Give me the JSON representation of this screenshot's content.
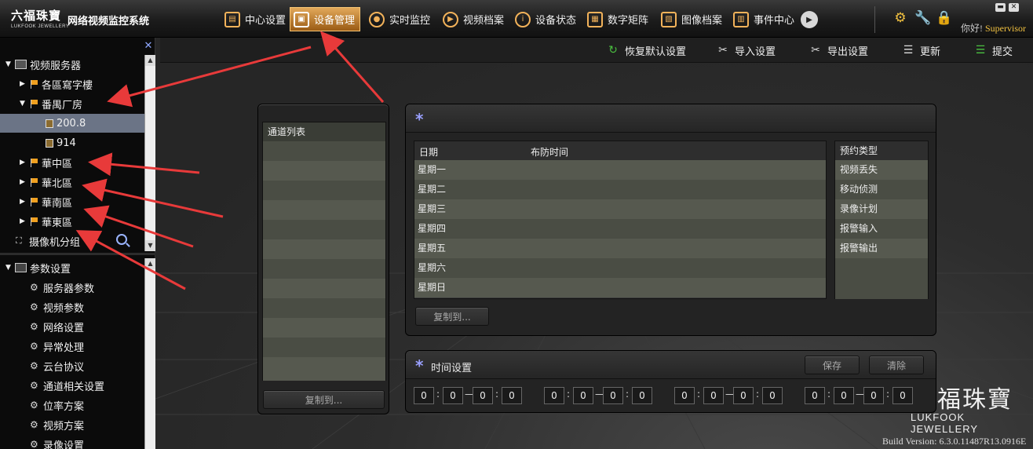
{
  "header": {
    "logo_cn": "六福珠寶",
    "logo_en": "LUKFOOK JEWELLERY",
    "app_title": "网络视频监控系统",
    "greeting": "你好!",
    "user": "Supervisor"
  },
  "nav": [
    {
      "label": "中心设置",
      "icon": "center-settings-icon",
      "glyph": "▤"
    },
    {
      "label": "设备管理",
      "icon": "device-management-icon",
      "glyph": "▣",
      "active": true
    },
    {
      "label": "实时监控",
      "icon": "live-monitor-icon",
      "glyph": "●"
    },
    {
      "label": "视频档案",
      "icon": "video-archive-icon",
      "glyph": "▶"
    },
    {
      "label": "设备状态",
      "icon": "device-status-icon",
      "glyph": "i"
    },
    {
      "label": "数字矩阵",
      "icon": "digital-matrix-icon",
      "glyph": "▦"
    },
    {
      "label": "图像档案",
      "icon": "image-archive-icon",
      "glyph": "▧"
    },
    {
      "label": "事件中心",
      "icon": "event-center-icon",
      "glyph": "▥"
    }
  ],
  "sidebar": {
    "tree": [
      {
        "label": "视频服务器",
        "level": 0,
        "expanded": true,
        "icon": "server-icon"
      },
      {
        "label": "各區寫字樓",
        "level": 1,
        "expanded": false,
        "icon": "flag-icon"
      },
      {
        "label": "番禺厂房",
        "level": 1,
        "expanded": true,
        "icon": "flag-icon"
      },
      {
        "label": "200.8",
        "level": 2,
        "icon": "device-icon",
        "selected": true
      },
      {
        "label": "914",
        "level": 2,
        "icon": "device-icon"
      },
      {
        "label": "華中區",
        "level": 1,
        "expanded": false,
        "icon": "flag-icon"
      },
      {
        "label": "華北區",
        "level": 1,
        "expanded": false,
        "icon": "flag-icon"
      },
      {
        "label": "華南區",
        "level": 1,
        "expanded": false,
        "icon": "flag-icon"
      },
      {
        "label": "華東區",
        "level": 1,
        "expanded": false,
        "icon": "flag-icon"
      },
      {
        "label": "摄像机分组",
        "level": 0,
        "icon": "camera-group-icon"
      }
    ],
    "params_title": "参数设置",
    "params": [
      "服务器参数",
      "视频参数",
      "网络设置",
      "异常处理",
      "云台协议",
      "通道相关设置",
      "位率方案",
      "视频方案",
      "录像设置"
    ]
  },
  "toolbar": [
    {
      "label": "恢复默认设置",
      "icon": "restore-default-icon"
    },
    {
      "label": "导入设置",
      "icon": "import-settings-icon"
    },
    {
      "label": "导出设置",
      "icon": "export-settings-icon"
    },
    {
      "label": "更新",
      "icon": "update-icon"
    },
    {
      "label": "提交",
      "icon": "submit-icon"
    }
  ],
  "channel_panel": {
    "title": "通道列表",
    "copy_button": "复制到..."
  },
  "schedule_panel": {
    "col_date": "日期",
    "col_time": "布防时间",
    "days": [
      "星期一",
      "星期二",
      "星期三",
      "星期四",
      "星期五",
      "星期六",
      "星期日"
    ],
    "type_header": "预约类型",
    "types": [
      "视频丢失",
      "移动侦测",
      "录像计划",
      "报警输入",
      "报警输出"
    ],
    "copy_button": "复制到..."
  },
  "time_panel": {
    "title": "时间设置",
    "save": "保存",
    "clear": "清除",
    "ranges": [
      [
        "0",
        "0",
        "0",
        "0"
      ],
      [
        "0",
        "0",
        "0",
        "0"
      ],
      [
        "0",
        "0",
        "0",
        "0"
      ],
      [
        "0",
        "0",
        "0",
        "0"
      ]
    ]
  },
  "brand": {
    "cn": "福珠寶",
    "en": "LUKFOOK JEWELLERY"
  },
  "build_version": "Build Version: 6.3.0.11487R13.0916E",
  "colors": {
    "accent": "#e0a050",
    "annotation_arrow": "#e83a3a",
    "selected_row": "#6b7486",
    "stripe_a": "#56594f",
    "stripe_b": "#4a4d44"
  }
}
